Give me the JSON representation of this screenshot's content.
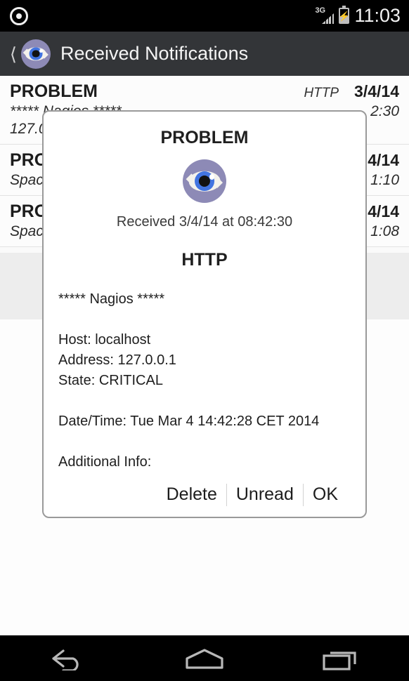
{
  "status_bar": {
    "notification_icon": "eye-icon",
    "network_label": "3G",
    "signal_icon": "signal-bars-icon",
    "battery_icon": "battery-charging-icon",
    "clock": "11:03"
  },
  "action_bar": {
    "back_icon": "back-chevron-icon",
    "app_icon": "eye-logo-icon",
    "title": "Received Notifications"
  },
  "list": {
    "rows": [
      {
        "title": "PROBLEM",
        "service": "HTTP",
        "date": "3/4/14",
        "message": "***** Nagios *****",
        "message2": "127.0.0.1",
        "time": "2:30"
      },
      {
        "title": "PROBLEM",
        "service": "",
        "date": "4/14",
        "message": "Space",
        "message2": "",
        "time": "1:10"
      },
      {
        "title": "PROBLEM",
        "service": "",
        "date": "4/14",
        "message": "Space",
        "message2": "",
        "time": "1:08"
      }
    ]
  },
  "dialog": {
    "title": "PROBLEM",
    "icon": "eye-logo-icon",
    "received": "Received 3/4/14 at 08:42:30",
    "service": "HTTP",
    "body": "***** Nagios *****\n\nHost: localhost\nAddress: 127.0.0.1\nState: CRITICAL\n\nDate/Time: Tue Mar 4 14:42:28 CET 2014\n\nAdditional Info:",
    "buttons": {
      "delete": "Delete",
      "unread": "Unread",
      "ok": "OK"
    }
  },
  "nav_bar": {
    "back": "back-nav-icon",
    "home": "home-nav-icon",
    "recents": "recent-apps-nav-icon"
  },
  "colors": {
    "status_bar_bg": "#000000",
    "action_bar_bg": "#333538",
    "list_bg": "#fcfcfc",
    "page_bg": "#ededed",
    "dialog_bg": "#ffffff",
    "dialog_border": "#9a9a9a",
    "eye_outer": "#8d8ab6",
    "eye_iris": "#4274e0",
    "eye_sclera": "#f4f2ec"
  }
}
